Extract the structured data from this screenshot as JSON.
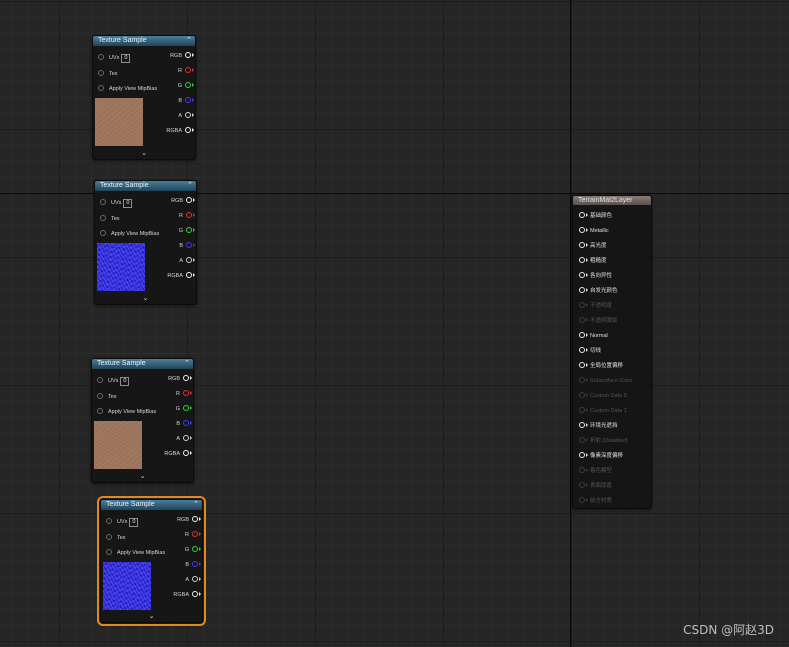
{
  "texture_nodes": [
    {
      "title": "Texture Sample",
      "uvs_label": "UVs",
      "uvs_value": "0",
      "tex_label": "Tex",
      "mipbias_label": "Apply View MipBias",
      "preview": "brown",
      "selected": false
    },
    {
      "title": "Texture Sample",
      "uvs_label": "UVs",
      "uvs_value": "0",
      "tex_label": "Tex",
      "mipbias_label": "Apply View MipBias",
      "preview": "normal",
      "selected": false
    },
    {
      "title": "Texture Sample",
      "uvs_label": "UVs",
      "uvs_value": "0",
      "tex_label": "Tex",
      "mipbias_label": "Apply View MipBias",
      "preview": "brown",
      "selected": false
    },
    {
      "title": "Texture Sample",
      "uvs_label": "UVs",
      "uvs_value": "0",
      "tex_label": "Tex",
      "mipbias_label": "Apply View MipBias",
      "preview": "normal",
      "selected": true
    }
  ],
  "output_pins": [
    {
      "label": "RGB",
      "color": "#f2f2f2"
    },
    {
      "label": "R",
      "color": "#e23030"
    },
    {
      "label": "G",
      "color": "#2fd22f"
    },
    {
      "label": "B",
      "color": "#3b3bff"
    },
    {
      "label": "A",
      "color": "#cfcfcf"
    },
    {
      "label": "RGBA",
      "color": "#f2f2f2"
    }
  ],
  "icons": {
    "collapse": "chevron-up-icon",
    "expand": "chevron-down-icon"
  },
  "layer_node": {
    "title": "TerrainMat2Layer",
    "pins": [
      {
        "label": "基础颜色",
        "enabled": true
      },
      {
        "label": "Metallic",
        "enabled": true
      },
      {
        "label": "高光度",
        "enabled": true
      },
      {
        "label": "粗糙度",
        "enabled": true
      },
      {
        "label": "各向异性",
        "enabled": true
      },
      {
        "label": "自发光颜色",
        "enabled": true
      },
      {
        "label": "不透明度",
        "enabled": false
      },
      {
        "label": "不透明蒙版",
        "enabled": false
      },
      {
        "label": "Normal",
        "enabled": true
      },
      {
        "label": "切线",
        "enabled": true
      },
      {
        "label": "全局位置偏移",
        "enabled": true
      },
      {
        "label": "Subsurface Color",
        "enabled": false
      },
      {
        "label": "Custom Data 0",
        "enabled": false
      },
      {
        "label": "Custom Data 1",
        "enabled": false
      },
      {
        "label": "环境光遮挡",
        "enabled": true
      },
      {
        "label": "折射 (Disabled)",
        "enabled": false
      },
      {
        "label": "像素深度偏移",
        "enabled": true
      },
      {
        "label": "着色模型",
        "enabled": false
      },
      {
        "label": "表面厚度",
        "enabled": false
      },
      {
        "label": "前方材质",
        "enabled": false
      }
    ]
  },
  "watermark": "CSDN @阿赵3D"
}
